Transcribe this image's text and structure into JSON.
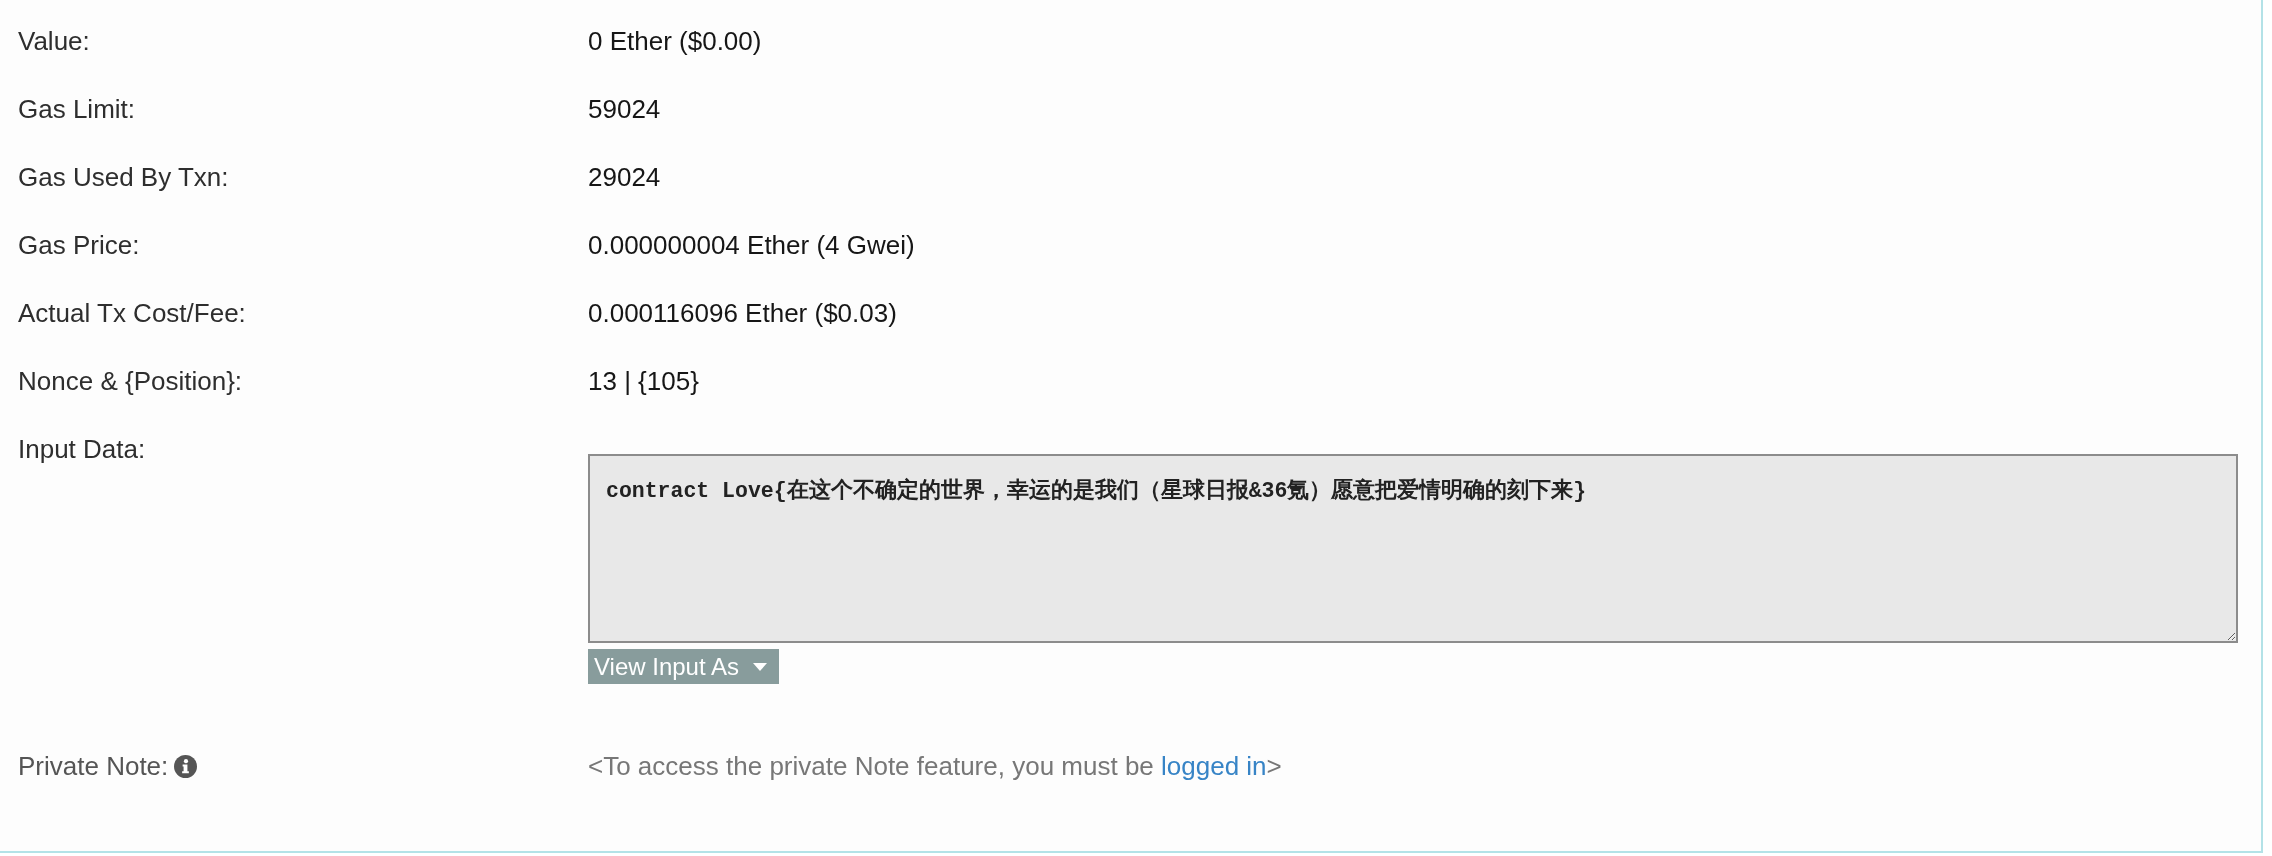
{
  "rows": [
    {
      "label": "Value:",
      "value": "0 Ether ($0.00)"
    },
    {
      "label": "Gas Limit:",
      "value": "59024"
    },
    {
      "label": "Gas Used By Txn:",
      "value": "29024"
    },
    {
      "label": "Gas Price:",
      "value": "0.000000004 Ether (4 Gwei)"
    },
    {
      "label": "Actual Tx Cost/Fee:",
      "value": "0.000116096 Ether ($0.03)"
    },
    {
      "label": "Nonce & {Position}:",
      "value": "13 | {105}"
    }
  ],
  "input_data": {
    "label": "Input Data:",
    "value": "contract Love{在这个不确定的世界，幸运的是我们（星球日报&36氪）愿意把爱情明确的刻下来}",
    "view_button": "View Input As"
  },
  "private_note": {
    "label": "Private Note:",
    "message_before": "<To access the private Note feature, you must be ",
    "link": "logged in",
    "message_after": ">"
  }
}
